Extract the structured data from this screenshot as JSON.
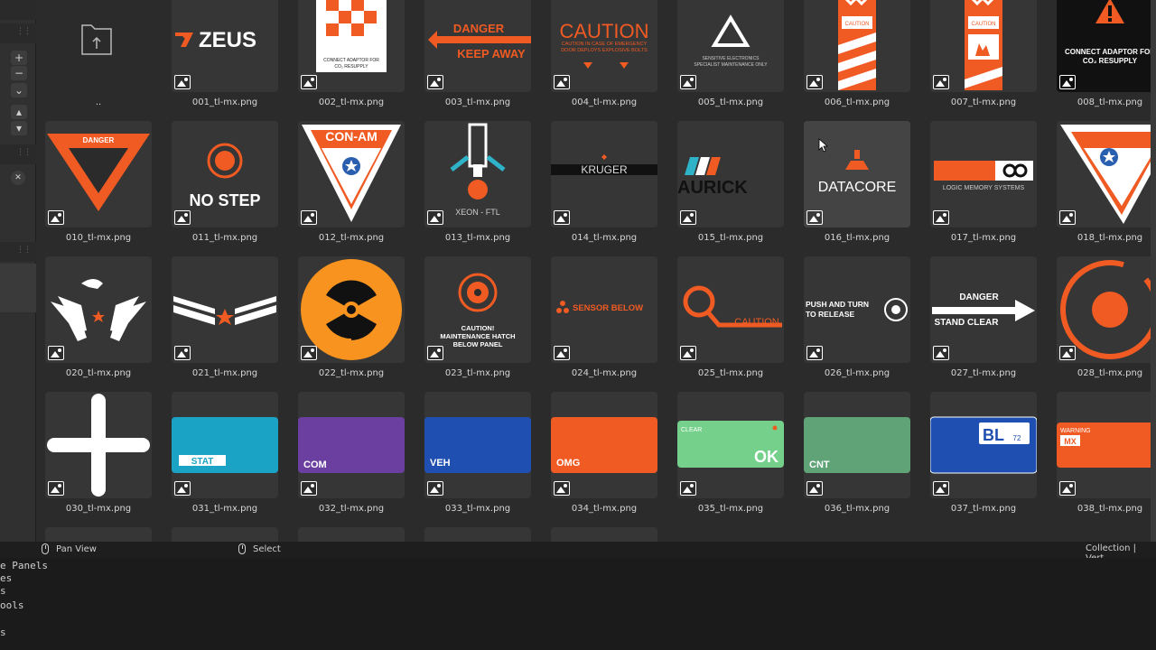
{
  "toolbar": {
    "icons": [
      "plus-icon",
      "minus-icon",
      "chevron-down-icon",
      "arrow-up-icon",
      "arrow-down-icon",
      "close-icon"
    ],
    "plus": "+",
    "minus": "−",
    "chevron": "⌄",
    "up": "▴",
    "down": "▾",
    "close": "✕"
  },
  "grid": {
    "row0": [
      "..",
      "001_tl-mx.png",
      "002_tl-mx.png",
      "003_tl-mx.png",
      "004_tl-mx.png",
      "005_tl-mx.png",
      "006_tl-mx.png",
      "007_tl-mx.png",
      "008_tl-mx.png"
    ],
    "row1": [
      "010_tl-mx.png",
      "011_tl-mx.png",
      "012_tl-mx.png",
      "013_tl-mx.png",
      "014_tl-mx.png",
      "015_tl-mx.png",
      "016_tl-mx.png",
      "017_tl-mx.png",
      "018_tl-mx.png"
    ],
    "row2": [
      "020_tl-mx.png",
      "021_tl-mx.png",
      "022_tl-mx.png",
      "023_tl-mx.png",
      "024_tl-mx.png",
      "025_tl-mx.png",
      "026_tl-mx.png",
      "027_tl-mx.png",
      "028_tl-mx.png"
    ],
    "row3": [
      "030_tl-mx.png",
      "031_tl-mx.png",
      "032_tl-mx.png",
      "033_tl-mx.png",
      "034_tl-mx.png",
      "035_tl-mx.png",
      "036_tl-mx.png",
      "037_tl-mx.png",
      "038_tl-mx.png"
    ]
  },
  "thumb_text": {
    "zeus": "ZEUS",
    "connect_adaptor": "CONNECT ADAPTOR FOR",
    "co2": "CO₂ RESUPPLY",
    "danger": "DANGER",
    "keep_away": "KEEP AWAY",
    "caution": "CAUTION",
    "caution_sub1": "CAUTION IN CASE OF EMERGENCY",
    "caution_sub2": "DOOR DEPLOYS EXPLOSIVE BOLTS",
    "sensitive1": "SENSITIVE ELECTRONICS",
    "sensitive2": "SPECIALIST MAINTENANCE ONLY",
    "caution_small": "CAUTION",
    "connect_adaptor_for": "CONNECT ADAPTOR FOR",
    "co2_resupply": "CO₂ RESUPPLY",
    "danger_tri": "DANGER",
    "no_step": "NO STEP",
    "con_am": "CON-AM",
    "xeon": "XEON - FTL",
    "krugger": "KRUGER",
    "aurick": "AURICK",
    "datacore": "DATACORE",
    "logic": "LOGIC MEMORY SYSTEMS",
    "caution_maint1": "CAUTION!",
    "caution_maint2": "MAINTENANCE HATCH",
    "caution_maint3": "BELOW PANEL",
    "sensor_below": "SENSOR BELOW",
    "caution_q": "CAUTION",
    "push1": "PUSH AND TURN",
    "push2": "TO RELEASE",
    "stand_danger": "DANGER",
    "stand_clear": "STAND CLEAR",
    "stat": "STAT",
    "com": "COM",
    "veh": "VEH",
    "omg": "OMG",
    "clear": "CLEAR",
    "ok": "OK",
    "cnt": "CNT",
    "bl": "BL",
    "bl_num": "72",
    "warning": "WARNING",
    "mx": "MX"
  },
  "status_bar": {
    "pan_view": "Pan View",
    "select": "Select",
    "collection": "Collection | Vert"
  },
  "console": {
    "lines": [
      "e Panels",
      "es",
      "s",
      "ools",
      "",
      "s"
    ]
  },
  "colors": {
    "orange": "#f05a23",
    "panel": "#363636",
    "background": "#2b2b2b"
  }
}
